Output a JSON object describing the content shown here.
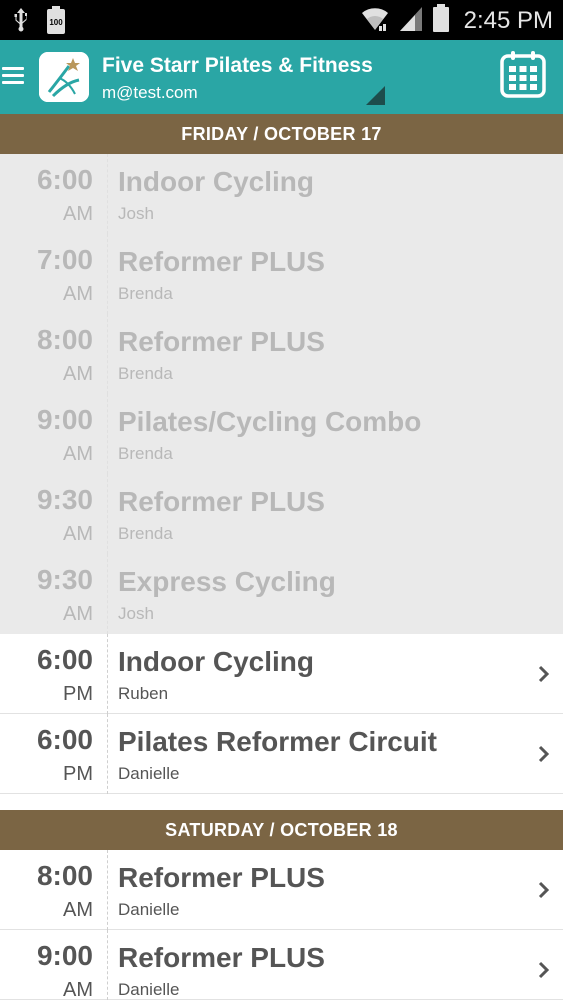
{
  "status_bar": {
    "time": "2:45 PM",
    "battery_small": "100",
    "icons": [
      "usb-icon",
      "battery-icon",
      "wifi-icon",
      "signal-icon",
      "battery-full-icon"
    ]
  },
  "header": {
    "studio_name": "Five Starr Pilates & Fitness",
    "email": "m@test.com",
    "menu_icon": "hamburger-menu-icon",
    "calendar_icon": "calendar-icon",
    "accent_color": "#2aa6a5"
  },
  "days": [
    {
      "label": "FRIDAY / OCTOBER 17",
      "classes": [
        {
          "hour": "6:00",
          "ampm": "AM",
          "title": "Indoor Cycling",
          "instructor": "Josh",
          "past": true
        },
        {
          "hour": "7:00",
          "ampm": "AM",
          "title": "Reformer PLUS",
          "instructor": "Brenda",
          "past": true
        },
        {
          "hour": "8:00",
          "ampm": "AM",
          "title": "Reformer PLUS",
          "instructor": "Brenda",
          "past": true
        },
        {
          "hour": "9:00",
          "ampm": "AM",
          "title": "Pilates/Cycling Combo",
          "instructor": "Brenda",
          "past": true
        },
        {
          "hour": "9:30",
          "ampm": "AM",
          "title": "Reformer PLUS",
          "instructor": "Brenda",
          "past": true
        },
        {
          "hour": "9:30",
          "ampm": "AM",
          "title": "Express Cycling",
          "instructor": "Josh",
          "past": true
        },
        {
          "hour": "6:00",
          "ampm": "PM",
          "title": "Indoor Cycling",
          "instructor": "Ruben",
          "past": false
        },
        {
          "hour": "6:00",
          "ampm": "PM",
          "title": "Pilates Reformer Circuit",
          "instructor": "Danielle",
          "past": false
        }
      ]
    },
    {
      "label": "SATURDAY / OCTOBER 18",
      "classes": [
        {
          "hour": "8:00",
          "ampm": "AM",
          "title": "Reformer PLUS",
          "instructor": "Danielle",
          "past": false
        },
        {
          "hour": "9:00",
          "ampm": "AM",
          "title": "Reformer PLUS",
          "instructor": "Danielle",
          "past": false
        }
      ]
    }
  ],
  "colors": {
    "day_header": "#7b6544",
    "past_row_bg": "#eaeaea",
    "text_dark": "#555555",
    "text_past": "#b8b8b8"
  }
}
